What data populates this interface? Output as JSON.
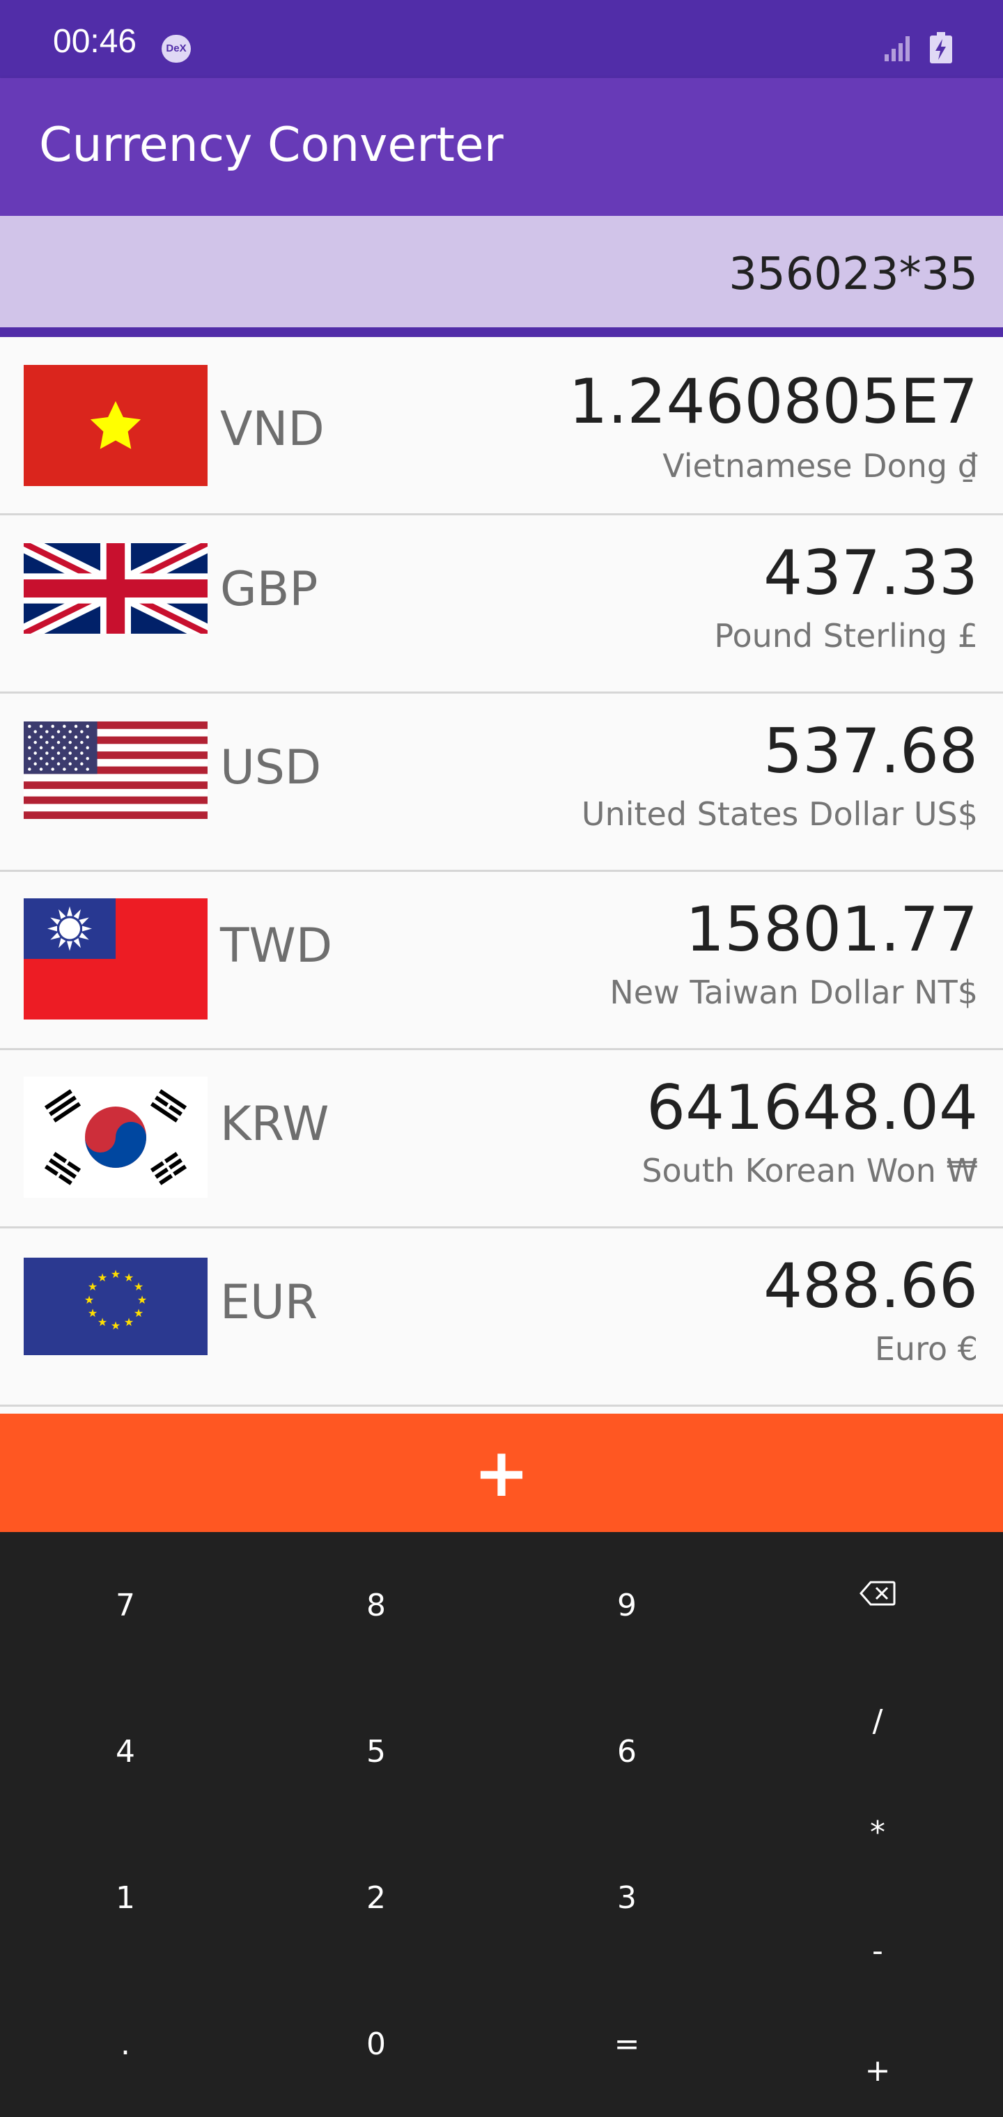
{
  "status_bar": {
    "time": "00:46",
    "dex_label": "DeX",
    "icons": [
      "signal-icon",
      "battery-charging-icon"
    ]
  },
  "app_bar": {
    "title": "Currency Converter"
  },
  "expression": {
    "value": "356023*35"
  },
  "currencies": [
    {
      "code": "VND",
      "value": "1.2460805E7",
      "name": "Vietnamese Dong ₫",
      "flag": "vietnam-flag-icon"
    },
    {
      "code": "GBP",
      "value": "437.33",
      "name": "Pound Sterling £",
      "flag": "uk-flag-icon"
    },
    {
      "code": "USD",
      "value": "537.68",
      "name": "United States Dollar US$",
      "flag": "us-flag-icon"
    },
    {
      "code": "TWD",
      "value": "15801.77",
      "name": "New Taiwan Dollar NT$",
      "flag": "taiwan-flag-icon"
    },
    {
      "code": "KRW",
      "value": "641648.04",
      "name": "South Korean Won ₩",
      "flag": "korea-flag-icon"
    },
    {
      "code": "EUR",
      "value": "488.66",
      "name": "Euro €",
      "flag": "eu-flag-icon"
    }
  ],
  "add_button": {
    "label": "+"
  },
  "keypad": {
    "digits": [
      "7",
      "8",
      "9",
      "4",
      "5",
      "6",
      "1",
      "2",
      "3",
      ".",
      "0",
      "="
    ],
    "backspace_icon": "backspace-icon",
    "operators": [
      "/",
      "*",
      "-",
      "+"
    ]
  },
  "colors": {
    "status_bar": "#512da8",
    "app_bar": "#673ab7",
    "expression_bg": "#d1c4e9",
    "add_button": "#ff5722",
    "keypad_bg": "#212121"
  }
}
